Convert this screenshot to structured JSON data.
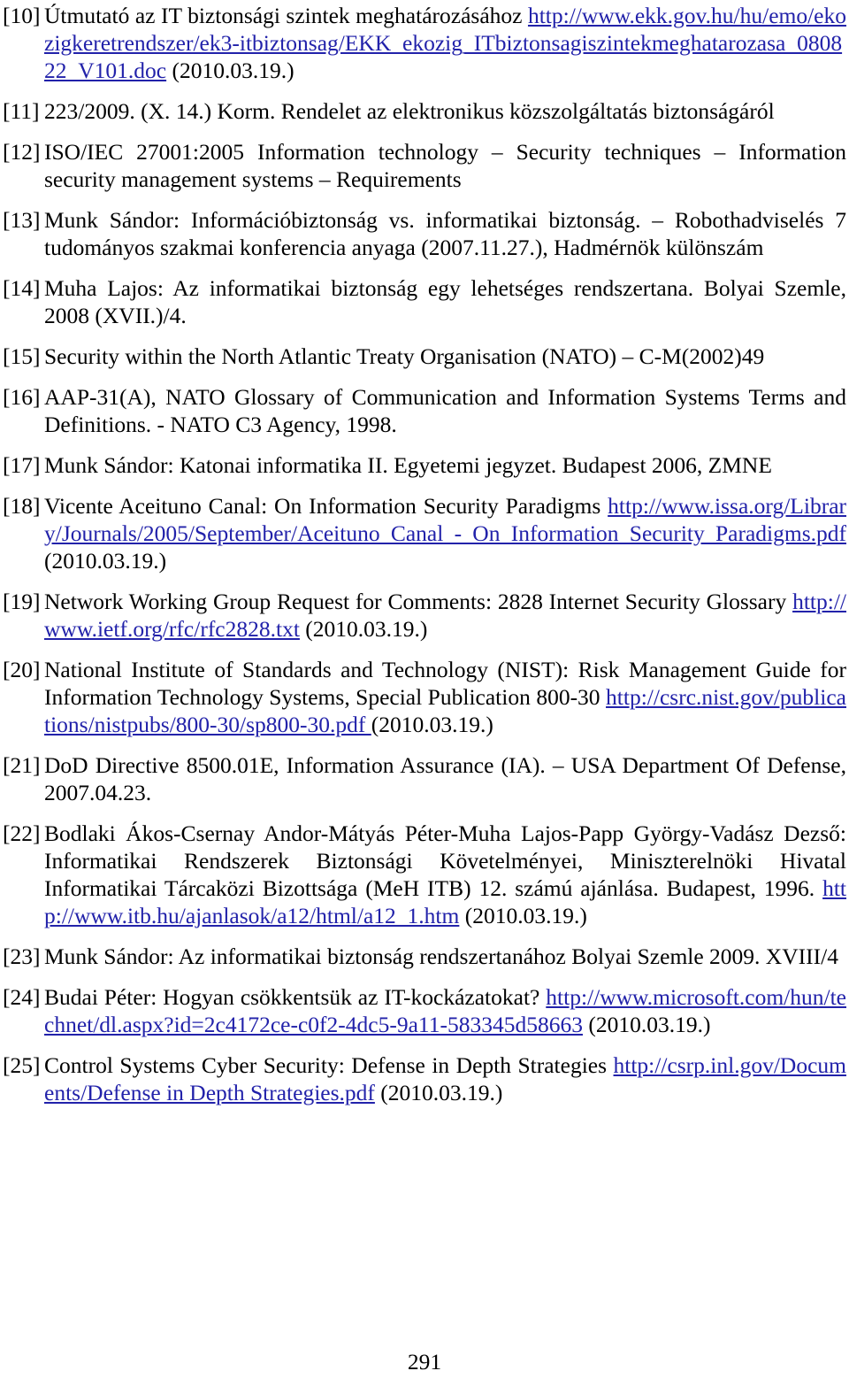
{
  "document": {
    "type": "references-list",
    "page_number": "291",
    "link_color": "#2222aa",
    "text_color": "#000000",
    "background": "#ffffff"
  },
  "references": [
    {
      "number": "[10]",
      "segments": [
        {
          "kind": "text",
          "value": "Útmutató az IT biztonsági szintek meghatározásához "
        },
        {
          "kind": "link",
          "value": "http://www.ekk.gov.hu/hu/emo/ekozigkeretrendszer/ek3-itbiztonsag/EKK_ekozig_ITbiztonsagiszintekmeghatarozasa_080822_V101.doc"
        },
        {
          "kind": "text",
          "value": " (2010.03.19.)"
        }
      ]
    },
    {
      "number": "[11]",
      "segments": [
        {
          "kind": "text",
          "value": "223/2009. (X. 14.) Korm. Rendelet az elektronikus közszolgáltatás biztonságáról"
        }
      ]
    },
    {
      "number": "[12]",
      "segments": [
        {
          "kind": "text",
          "value": "ISO/IEC 27001:2005 Information technology – Security techniques – Information security management systems – Requirements"
        }
      ]
    },
    {
      "number": "[13]",
      "segments": [
        {
          "kind": "text",
          "value": "Munk Sándor: Információbiztonság vs. informatikai biztonság. – Robothadviselés 7 tudományos szakmai konferencia anyaga (2007.11.27.), Hadmérnök különszám"
        }
      ]
    },
    {
      "number": "[14]",
      "segments": [
        {
          "kind": "text",
          "value": "Muha Lajos: Az informatikai biztonság egy lehetséges rendszertana. Bolyai Szemle, 2008 (XVII.)/4."
        }
      ]
    },
    {
      "number": "[15]",
      "segments": [
        {
          "kind": "text",
          "value": "Security within the North Atlantic Treaty Organisation (NATO) – C-M(2002)49"
        }
      ]
    },
    {
      "number": "[16]",
      "segments": [
        {
          "kind": "text",
          "value": "AAP-31(A), NATO Glossary of Communication and Information Systems Terms and Definitions. - NATO C3 Agency, 1998."
        }
      ]
    },
    {
      "number": "[17]",
      "segments": [
        {
          "kind": "text",
          "value": "Munk Sándor: Katonai informatika II. Egyetemi jegyzet. Budapest 2006, ZMNE"
        }
      ]
    },
    {
      "number": "[18]",
      "segments": [
        {
          "kind": "text",
          "value": "Vicente Aceituno Canal: On Information Security Paradigms "
        },
        {
          "kind": "link",
          "value": "http://www.issa.org/Library/Journals/2005/September/Aceituno Canal - On Information Security Paradigms.pdf "
        },
        {
          "kind": "text",
          "value": "(2010.03.19.)"
        }
      ]
    },
    {
      "number": "[19]",
      "segments": [
        {
          "kind": "text",
          "value": "Network Working Group Request for Comments: 2828 Internet Security Glossary "
        },
        {
          "kind": "link",
          "value": "http://www.ietf.org/rfc/rfc2828.txt"
        },
        {
          "kind": "text",
          "value": " (2010.03.19.)"
        }
      ]
    },
    {
      "number": "[20]",
      "segments": [
        {
          "kind": "text",
          "value": "National Institute of Standards and Technology (NIST): Risk Management Guide for Information Technology Systems, Special Publication 800-30 "
        },
        {
          "kind": "link",
          "value": "http://csrc.nist.gov/publications/nistpubs/800-30/sp800-30.pdf "
        },
        {
          "kind": "text",
          "value": "(2010.03.19.)"
        }
      ]
    },
    {
      "number": "[21]",
      "segments": [
        {
          "kind": "text",
          "value": "DoD Directive 8500.01E, Information Assurance (IA). – USA Department Of Defense, 2007.04.23."
        }
      ]
    },
    {
      "number": "[22]",
      "segments": [
        {
          "kind": "text",
          "value": "Bodlaki Ákos-Csernay Andor-Mátyás Péter-Muha Lajos-Papp György-Vadász Dezső: Informatikai Rendszerek Biztonsági Követelményei, Miniszterelnöki Hivatal Informatikai Tárcaközi Bizottsága (MeH ITB) 12. számú ajánlása. Budapest, 1996. "
        },
        {
          "kind": "link",
          "value": "http://www.itb.hu/ajanlasok/a12/html/a12_1.htm"
        },
        {
          "kind": "text",
          "value": " (2010.03.19.)"
        }
      ]
    },
    {
      "number": "[23]",
      "segments": [
        {
          "kind": "text",
          "value": "Munk Sándor: Az informatikai biztonság rendszertanához Bolyai Szemle 2009. XVIII/4"
        }
      ]
    },
    {
      "number": "[24]",
      "segments": [
        {
          "kind": "text",
          "value": "Budai Péter: Hogyan csökkentsük az IT-kockázatokat? "
        },
        {
          "kind": "link",
          "value": "http://www.microsoft.com/hun/technet/dl.aspx?id=2c4172ce-c0f2-4dc5-9a11-583345d58663"
        },
        {
          "kind": "text",
          "value": " (2010.03.19.)"
        }
      ]
    },
    {
      "number": "[25]",
      "segments": [
        {
          "kind": "text",
          "value": "Control Systems Cyber Security: Defense in Depth Strategies "
        },
        {
          "kind": "link",
          "value": "http://csrp.inl.gov/Documents/Defense in Depth Strategies.pdf"
        },
        {
          "kind": "text",
          "value": " (2010.03.19.)"
        }
      ]
    }
  ]
}
